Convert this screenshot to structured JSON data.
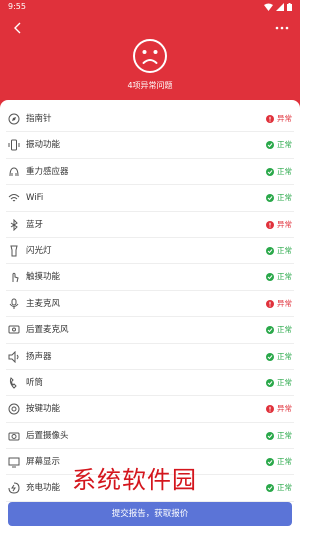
{
  "status_bar": {
    "time": "9:55"
  },
  "colors": {
    "header": "#e0313b",
    "ok": "#2aa84a",
    "bad": "#e0313b",
    "button": "#5b74d7"
  },
  "header": {
    "summary": "4项异常问题"
  },
  "items": [
    {
      "label": "指南针",
      "status": "异常",
      "state": "bad",
      "icon": "compass-icon"
    },
    {
      "label": "振动功能",
      "status": "正常",
      "state": "ok",
      "icon": "vibrate-icon"
    },
    {
      "label": "重力感应器",
      "status": "正常",
      "state": "ok",
      "icon": "gravity-sensor-icon"
    },
    {
      "label": "WiFi",
      "status": "正常",
      "state": "ok",
      "icon": "wifi-icon"
    },
    {
      "label": "蓝牙",
      "status": "异常",
      "state": "bad",
      "icon": "bluetooth-icon"
    },
    {
      "label": "闪光灯",
      "status": "正常",
      "state": "ok",
      "icon": "flashlight-icon"
    },
    {
      "label": "触摸功能",
      "status": "正常",
      "state": "ok",
      "icon": "touch-icon"
    },
    {
      "label": "主麦克风",
      "status": "异常",
      "state": "bad",
      "icon": "microphone-icon"
    },
    {
      "label": "后置麦克风",
      "status": "正常",
      "state": "ok",
      "icon": "rear-microphone-icon"
    },
    {
      "label": "扬声器",
      "status": "正常",
      "state": "ok",
      "icon": "speaker-icon"
    },
    {
      "label": "听筒",
      "status": "正常",
      "state": "ok",
      "icon": "earpiece-icon"
    },
    {
      "label": "按键功能",
      "status": "异常",
      "state": "bad",
      "icon": "keys-icon"
    },
    {
      "label": "后置摄像头",
      "status": "正常",
      "state": "ok",
      "icon": "camera-icon"
    },
    {
      "label": "屏幕显示",
      "status": "正常",
      "state": "ok",
      "icon": "screen-icon"
    },
    {
      "label": "充电功能",
      "status": "正常",
      "state": "ok",
      "icon": "charging-icon"
    }
  ],
  "submit_label": "提交报告，获取报价",
  "watermark": "系统软件园"
}
